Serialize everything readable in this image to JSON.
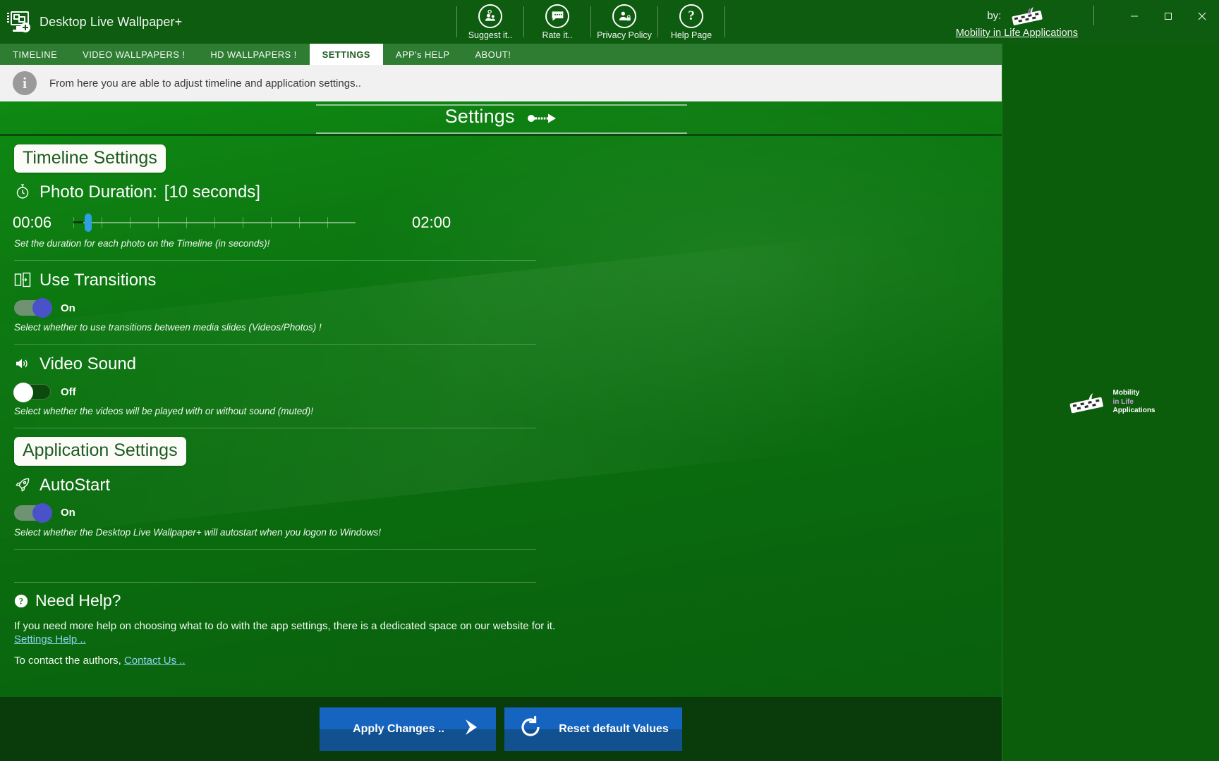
{
  "window": {
    "title": "Desktop Live Wallpaper+",
    "app_icon": "monitor-photos-plus-icon",
    "minimize_label": "Minimize",
    "maximize_label": "Maximize",
    "close_label": "Close"
  },
  "toolbar": {
    "items": [
      {
        "label": "Suggest it..",
        "icon": "suggest-people-icon"
      },
      {
        "label": "Rate it..",
        "icon": "chat-bubble-icon"
      },
      {
        "label": "Privacy Policy",
        "icon": "person-lock-icon"
      },
      {
        "label": "Help Page",
        "icon": "question-mark-icon"
      }
    ]
  },
  "branding": {
    "by_label": "by:",
    "company": "Mobility in Life Applications",
    "logo": "keyboard-hand-logo"
  },
  "tabs": [
    {
      "label": "TIMELINE",
      "active": false
    },
    {
      "label": "VIDEO WALLPAPERS !",
      "active": false
    },
    {
      "label": "HD WALLPAPERS !",
      "active": false
    },
    {
      "label": "SETTINGS",
      "active": true
    },
    {
      "label": "APP's HELP",
      "active": false
    },
    {
      "label": "ABOUT!",
      "active": false
    }
  ],
  "infobar": {
    "icon": "info-icon",
    "text": "From here you are able to adjust timeline and application settings.."
  },
  "page": {
    "title": "Settings",
    "title_arrow": "key-arrow-icon"
  },
  "sections": [
    {
      "chip": "Timeline Settings",
      "settings": [
        {
          "name": "photo-duration",
          "icon": "stopwatch-icon",
          "label": "Photo Duration:",
          "value": "[10 seconds]",
          "control": "slider",
          "min_label": "00:06",
          "max_label": "02:00",
          "hint": "Set the duration for each photo on the Timeline (in seconds)!"
        },
        {
          "name": "use-transitions",
          "icon": "transition-slides-icon",
          "label": "Use Transitions",
          "control": "toggle",
          "state": "On",
          "hint": "Select whether to use transitions between media slides (Videos/Photos) !"
        },
        {
          "name": "video-sound",
          "icon": "speaker-icon",
          "label": "Video Sound",
          "control": "toggle",
          "state": "Off",
          "hint": "Select whether the videos will be played with or without sound (muted)!"
        }
      ]
    },
    {
      "chip": "Application Settings",
      "settings": [
        {
          "name": "autostart",
          "icon": "rocket-icon",
          "label": "AutoStart",
          "control": "toggle",
          "state": "On",
          "hint": "Select whether the Desktop Live Wallpaper+ will autostart when you logon to Windows!"
        }
      ]
    }
  ],
  "help": {
    "icon": "question-circle-icon",
    "title": "Need Help?",
    "paragraph": "If you need more help on choosing what to do with the app settings, there is a dedicated space on our website for it.",
    "settings_help_link": "Settings Help ..",
    "contact_prefix": "To contact the authors,",
    "contact_link": "Contact Us .."
  },
  "footer": {
    "apply_label": "Apply Changes ..",
    "apply_icon": "play-arrow-icon",
    "reset_label": "Reset default Values",
    "reset_icon": "refresh-ccw-icon"
  },
  "ad_panel": {
    "logo_line1": "Mobility",
    "logo_line2": "in Life",
    "logo_line3": "Applications"
  },
  "colors": {
    "titlebar_green": "#0e5c10",
    "tab_green": "#2e7d32",
    "panel_green": "#0d7a11",
    "footer_green": "#0a3c0b",
    "button_blue": "#1565c0",
    "toggle_on_knob": "#4a52c9",
    "slider_thumb": "#2e9fe0",
    "link_blue": "#8fd3ef"
  }
}
